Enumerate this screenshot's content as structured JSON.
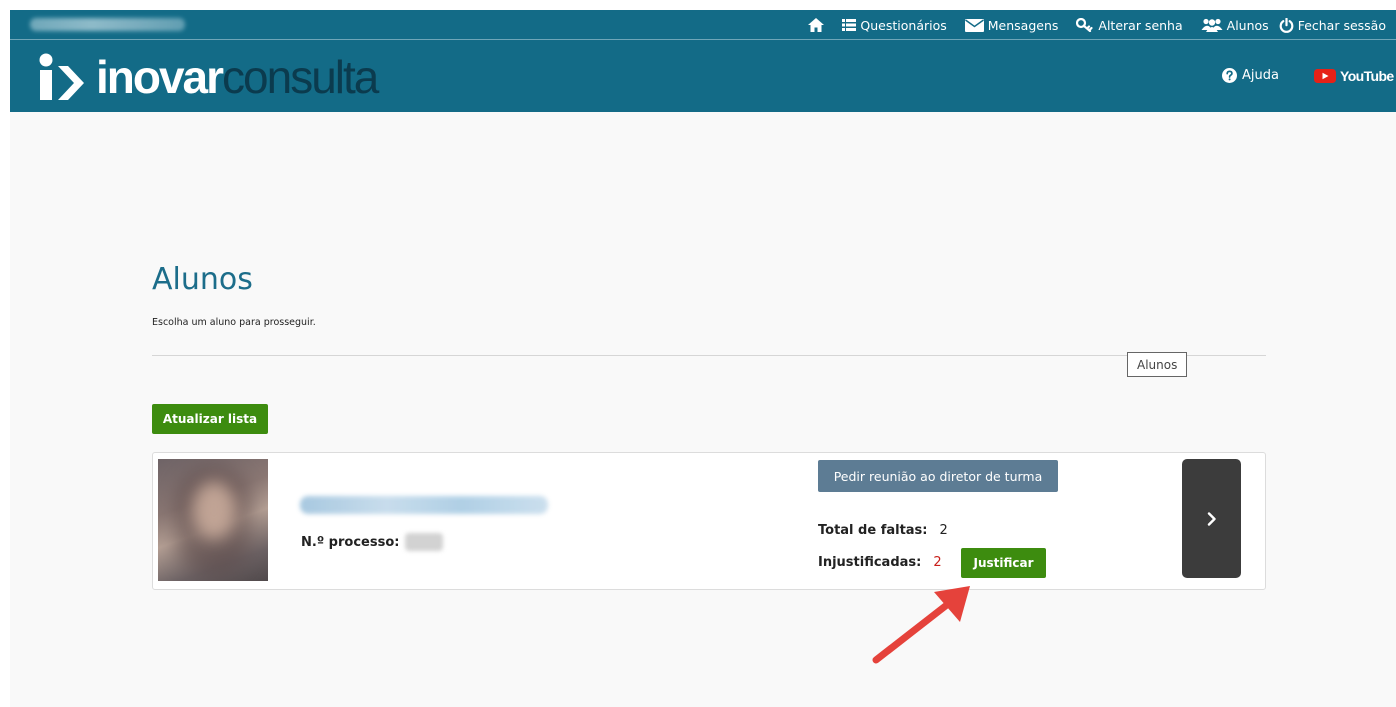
{
  "top_nav": {
    "questionarios": "Questionários",
    "mensagens": "Mensagens",
    "alterar_senha": "Alterar senha",
    "alunos": "Alunos",
    "fechar_sessao": "Fechar sessão"
  },
  "brand": {
    "logo_bold": "inovar",
    "logo_light": "consulta",
    "help_label": "Ajuda",
    "youtube_label": "YouTube"
  },
  "page": {
    "title": "Alunos",
    "subtitle": "Escolha um aluno para prosseguir.",
    "section_tag": "Alunos",
    "refresh_button": "Atualizar lista"
  },
  "student": {
    "process_label": "N.º processo:",
    "meeting_button": "Pedir reunião ao diretor de turma",
    "total_label": "Total de faltas:",
    "total_value": "2",
    "unjustified_label": "Injustificadas:",
    "unjustified_value": "2",
    "justify_button": "Justificar"
  },
  "colors": {
    "header": "#136b87",
    "accent_green": "#3d8c0f",
    "title_blue": "#1c6d8a",
    "alert_red": "#c9201b",
    "annotation_arrow": "#e5423b"
  },
  "icons": {
    "home": "home-icon",
    "questionnaires": "list-icon",
    "messages": "envelope-icon",
    "password": "key-icon",
    "students": "users-icon",
    "logout": "power-icon",
    "help": "question-circle-icon",
    "youtube": "youtube-play-icon",
    "next": "chevron-right-icon"
  }
}
